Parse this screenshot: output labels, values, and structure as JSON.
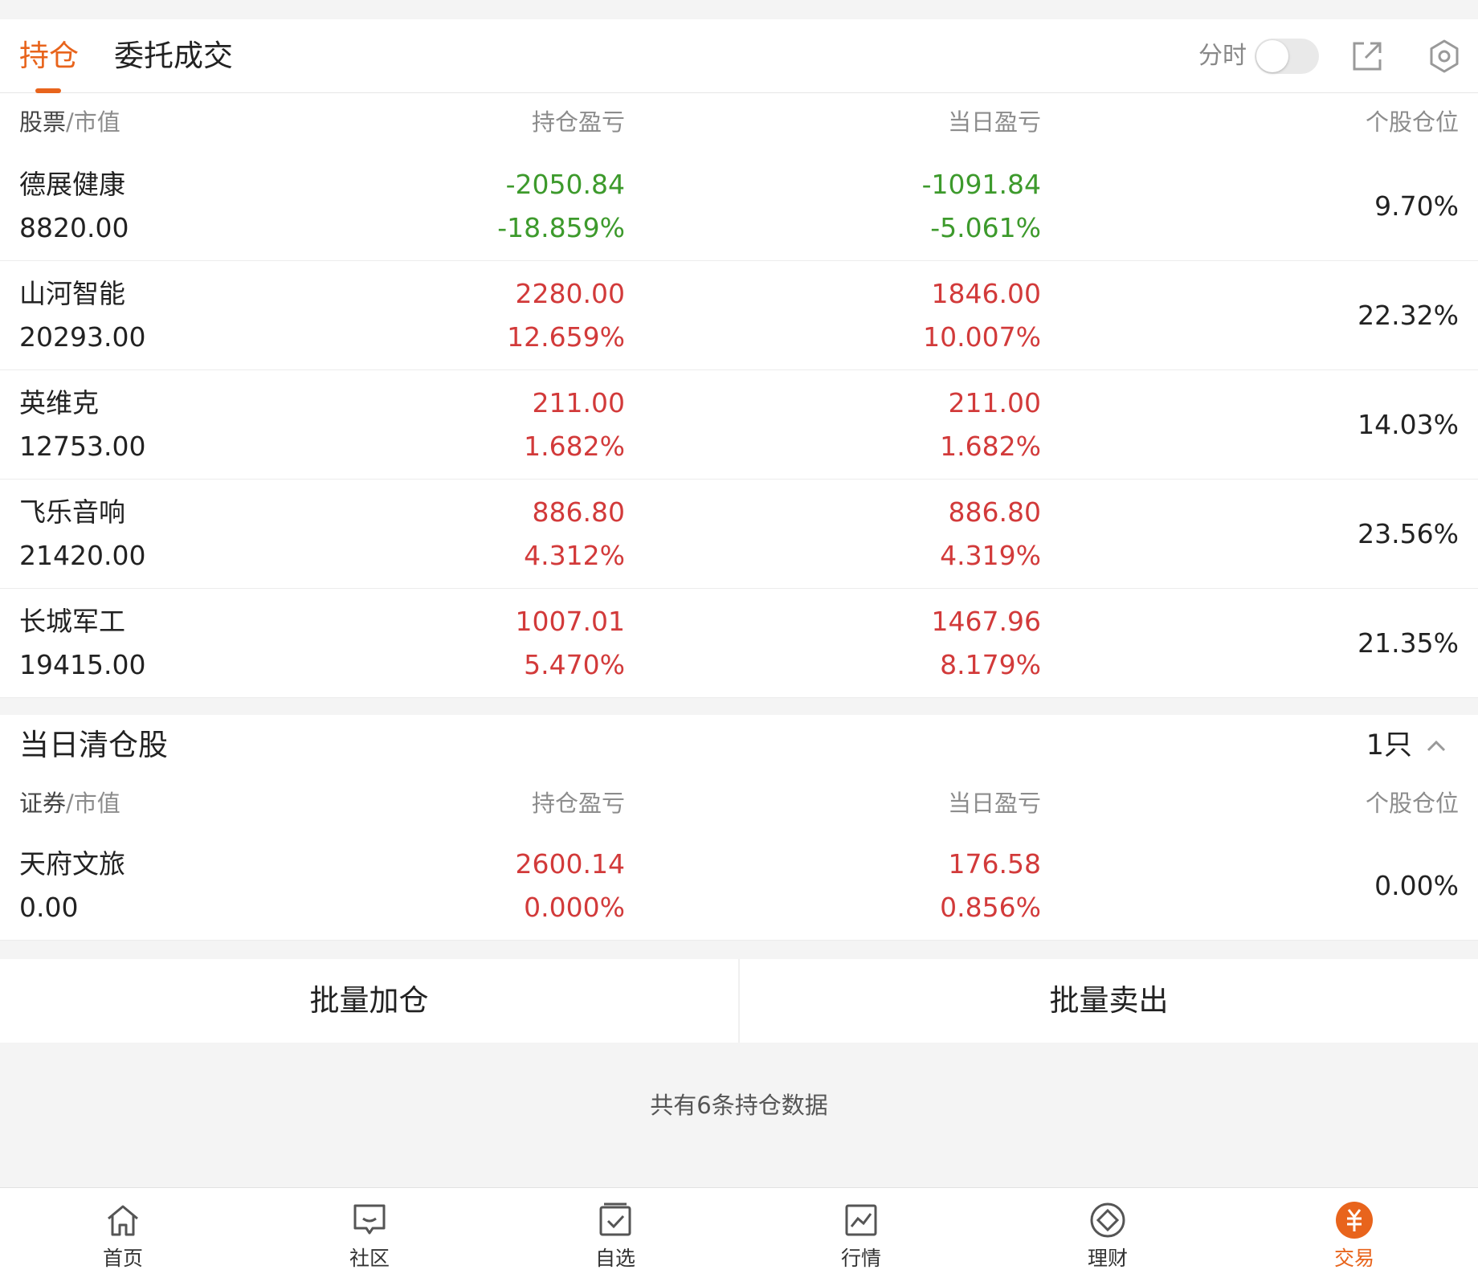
{
  "tabs": {
    "positions": "持仓",
    "orders": "委托成交"
  },
  "toolbar": {
    "fenshi_label": "分时",
    "fenshi_on": false,
    "share_icon": "share-icon",
    "settings_icon": "gear-icon"
  },
  "colors": {
    "accent": "#e8641c",
    "gain": "#d23a3a",
    "loss": "#3d9a2c"
  },
  "holdings": {
    "header": {
      "col1_a": "股票",
      "col1_b": "/市值",
      "col2": "持仓盈亏",
      "col3": "当日盈亏",
      "col4": "个股仓位"
    },
    "rows": [
      {
        "name": "德展健康",
        "market_value": "8820.00",
        "pnl": "-2050.84",
        "pnl_pct": "-18.859%",
        "day_pnl": "-1091.84",
        "day_pnl_pct": "-5.061%",
        "weight": "9.70%",
        "trend": "loss"
      },
      {
        "name": "山河智能",
        "market_value": "20293.00",
        "pnl": "2280.00",
        "pnl_pct": "12.659%",
        "day_pnl": "1846.00",
        "day_pnl_pct": "10.007%",
        "weight": "22.32%",
        "trend": "gain"
      },
      {
        "name": "英维克",
        "market_value": "12753.00",
        "pnl": "211.00",
        "pnl_pct": "1.682%",
        "day_pnl": "211.00",
        "day_pnl_pct": "1.682%",
        "weight": "14.03%",
        "trend": "gain"
      },
      {
        "name": "飞乐音响",
        "market_value": "21420.00",
        "pnl": "886.80",
        "pnl_pct": "4.312%",
        "day_pnl": "886.80",
        "day_pnl_pct": "4.319%",
        "weight": "23.56%",
        "trend": "gain"
      },
      {
        "name": "长城军工",
        "market_value": "19415.00",
        "pnl": "1007.01",
        "pnl_pct": "5.470%",
        "day_pnl": "1467.96",
        "day_pnl_pct": "8.179%",
        "weight": "21.35%",
        "trend": "gain"
      }
    ]
  },
  "cleared": {
    "title": "当日清仓股",
    "count": "1只",
    "header": {
      "col1_a": "证券",
      "col1_b": "/市值",
      "col2": "持仓盈亏",
      "col3": "当日盈亏",
      "col4": "个股仓位"
    },
    "rows": [
      {
        "name": "天府文旅",
        "market_value": "0.00",
        "pnl": "2600.14",
        "pnl_pct": "0.000%",
        "day_pnl": "176.58",
        "day_pnl_pct": "0.856%",
        "weight": "0.00%",
        "trend": "gain"
      }
    ]
  },
  "actions": {
    "batch_add": "批量加仓",
    "batch_sell": "批量卖出"
  },
  "footer_note": "共有6条持仓数据",
  "bottom_nav": [
    {
      "label": "首页",
      "icon": "home-icon",
      "active": false
    },
    {
      "label": "社区",
      "icon": "chat-icon",
      "active": false
    },
    {
      "label": "自选",
      "icon": "watchlist-icon",
      "active": false
    },
    {
      "label": "行情",
      "icon": "chart-icon",
      "active": false
    },
    {
      "label": "理财",
      "icon": "wealth-icon",
      "active": false
    },
    {
      "label": "交易",
      "icon": "trade-icon",
      "active": true
    }
  ]
}
